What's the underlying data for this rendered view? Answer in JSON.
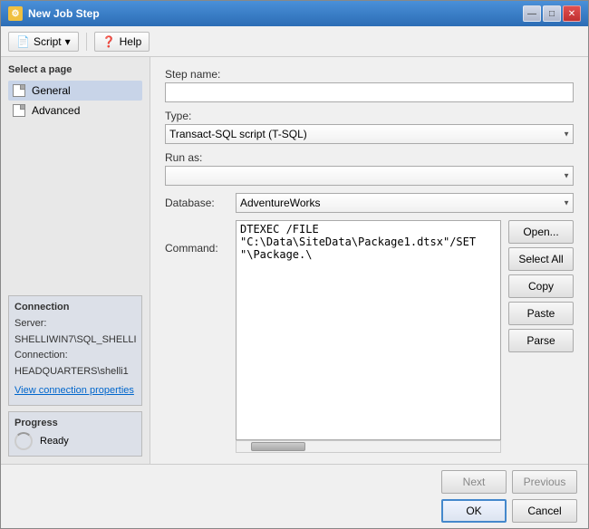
{
  "window": {
    "title": "New Job Step",
    "controls": {
      "minimize": "—",
      "maximize": "□",
      "close": "✕"
    }
  },
  "toolbar": {
    "script_label": "Script",
    "help_label": "Help",
    "dropdown_arrow": "▾"
  },
  "sidebar": {
    "select_page_label": "Select a page",
    "items": [
      {
        "label": "General",
        "selected": true
      },
      {
        "label": "Advanced",
        "selected": false
      }
    ],
    "connection_header": "Connection",
    "server_label": "Server:",
    "server_value": "SHELLIWIN7\\SQL_SHELLI",
    "connection_label": "Connection:",
    "connection_value": "HEADQUARTERS\\shelli1",
    "view_properties_link": "View connection properties",
    "progress_header": "Progress",
    "progress_status": "Ready"
  },
  "form": {
    "step_name_label": "Step name:",
    "step_name_value": "",
    "type_label": "Type:",
    "type_value": "Transact-SQL script (T-SQL)",
    "run_as_label": "Run as:",
    "run_as_value": "",
    "database_label": "Database:",
    "database_value": "AdventureWorks",
    "command_label": "Command:",
    "command_value": "DTEXEC /FILE \"C:\\Data\\SiteData\\Package1.dtsx\"/SET \"\\Package.\\"
  },
  "command_buttons": {
    "open": "Open...",
    "select_all": "Select All",
    "copy": "Copy",
    "paste": "Paste",
    "parse": "Parse"
  },
  "nav_buttons": {
    "next": "Next",
    "previous": "Previous"
  },
  "action_buttons": {
    "ok": "OK",
    "cancel": "Cancel"
  }
}
